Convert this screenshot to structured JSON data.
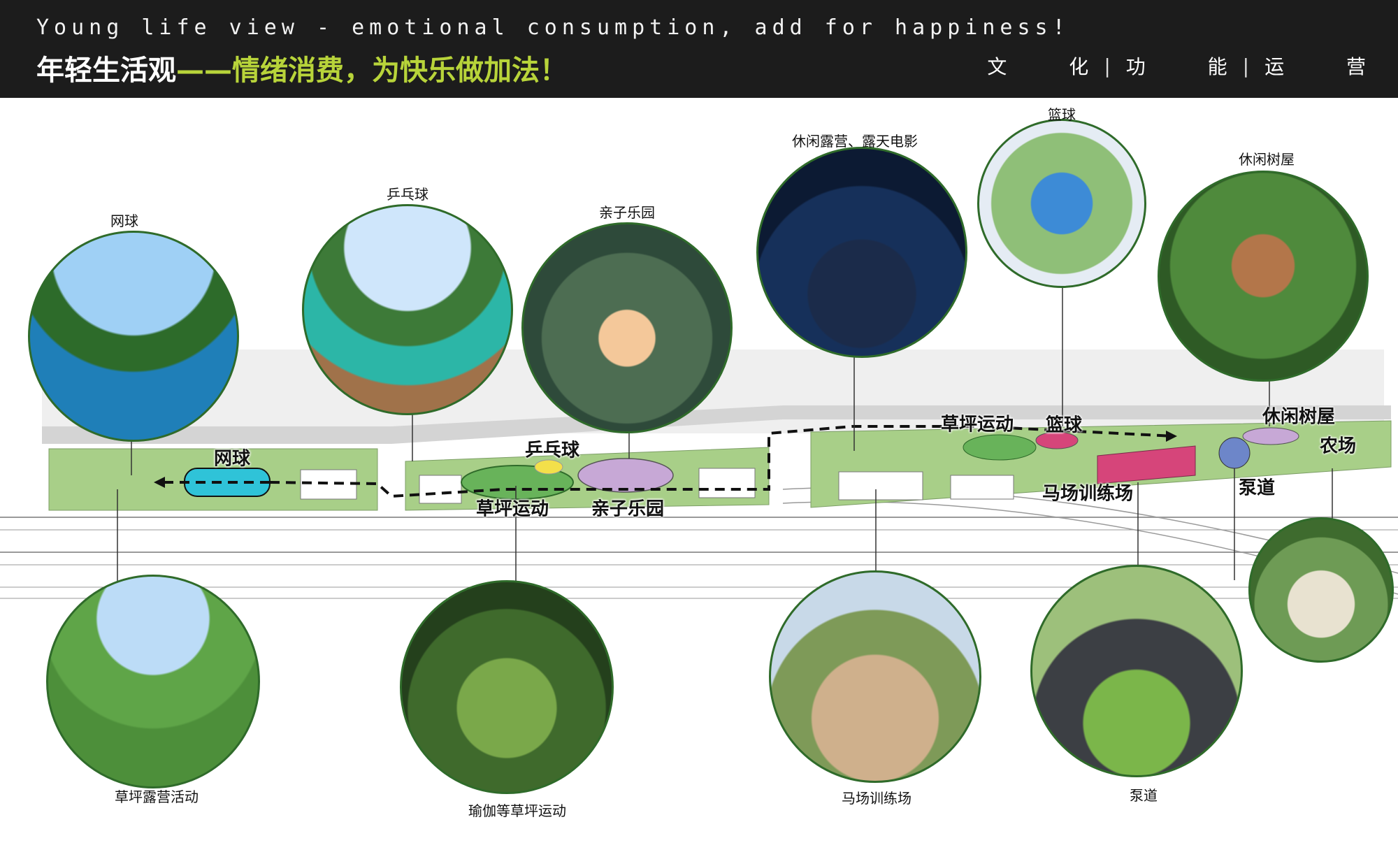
{
  "header": {
    "subtitle_en": "Young life view - emotional consumption, add for happiness!",
    "title_white": "年轻生活观",
    "title_dash": "——",
    "title_green": "情绪消费，为快乐做加法！",
    "nav": [
      "文  化",
      "功  能",
      "运  营"
    ],
    "nav_separator": "|"
  },
  "photos": {
    "tennis": "网球",
    "pingpong": "乒乓球",
    "kids_park": "亲子乐园",
    "camping_movie": "休闲露营、露天电影",
    "basketball": "篮球",
    "treehouse": "休闲树屋",
    "lawn_camping": "草坪露营活动",
    "yoga": "瑜伽等草坪运动",
    "horse": "马场训练场",
    "pump_track": "泵道"
  },
  "plan_labels": {
    "tennis": "网球",
    "pingpong": "乒乓球",
    "lawn_sport_left": "草坪运动",
    "kids_park": "亲子乐园",
    "lawn_sport_right": "草坪运动",
    "basketball": "篮球",
    "treehouse": "休闲树屋",
    "farm": "农场",
    "horse": "马场训练场",
    "pump_track": "泵道"
  },
  "colors": {
    "header_bg": "#1c1c1c",
    "accent_green": "#b8d43a",
    "park_green": "#9cc77e",
    "route_black": "#111111",
    "road_gray": "#d4d4d4",
    "zone_cyan": "#2fc3d8",
    "zone_purple": "#c7a8d6",
    "zone_pink": "#d6457a",
    "circle_border": "#2f6b2a"
  }
}
